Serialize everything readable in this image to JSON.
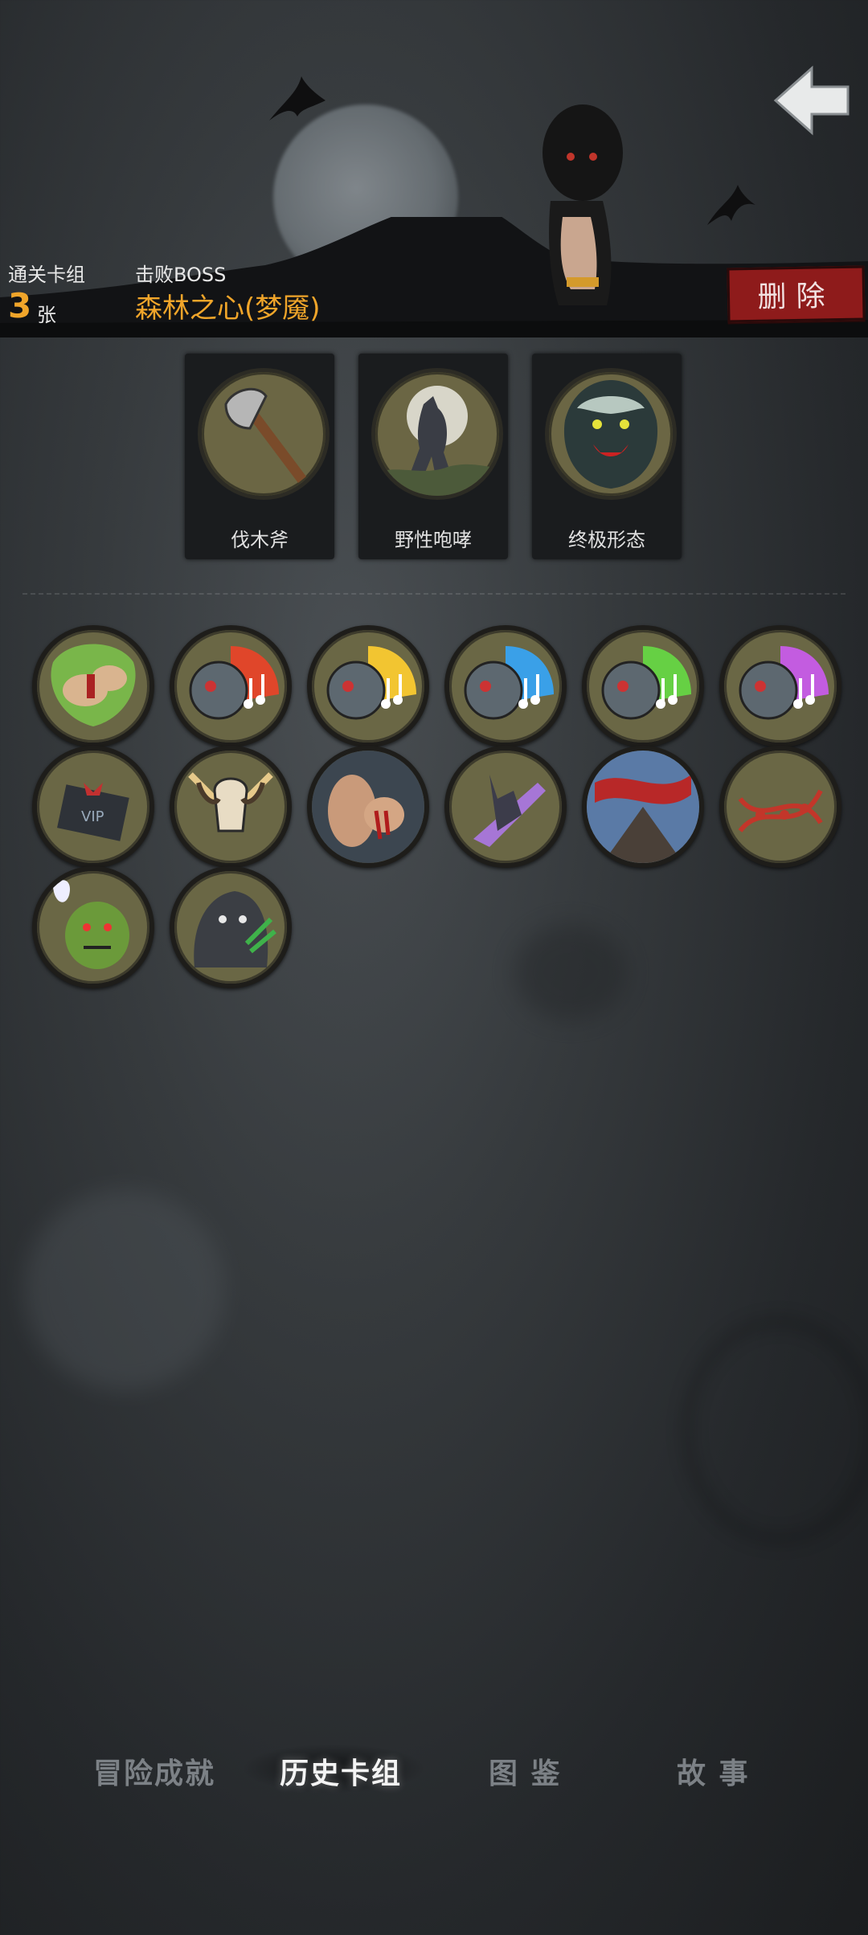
{
  "header": {
    "stats": {
      "deck_label": "通关卡组",
      "deck_count": "3",
      "deck_unit": "张",
      "boss_label": "击败BOSS",
      "boss_name": "森林之心(梦魇)"
    },
    "delete_label": "删除",
    "back_icon": "back-arrow-icon"
  },
  "boss_cards": [
    {
      "label": "伐木斧",
      "icon": "axe-icon"
    },
    {
      "label": "野性咆哮",
      "icon": "werewolf-howl-icon"
    },
    {
      "label": "终极形态",
      "icon": "werewolf-beast-icon"
    }
  ],
  "deck_cards": [
    {
      "icon": "green-fists-icon",
      "accent": "#7fd04c"
    },
    {
      "icon": "zombie-music-red-icon",
      "accent": "#e0462a"
    },
    {
      "icon": "zombie-music-yellow-icon",
      "accent": "#f2c531"
    },
    {
      "icon": "zombie-music-blue-icon",
      "accent": "#3aa0e8"
    },
    {
      "icon": "zombie-music-green-icon",
      "accent": "#66d044"
    },
    {
      "icon": "zombie-music-purple-icon",
      "accent": "#c35ce0"
    },
    {
      "icon": "vip-gift-icon",
      "accent": "#c23030"
    },
    {
      "icon": "horned-skull-icon",
      "accent": "#e6c98a"
    },
    {
      "icon": "bloody-fist-icon",
      "accent": "#b01c1c"
    },
    {
      "icon": "unicorn-beast-icon",
      "accent": "#a676d6"
    },
    {
      "icon": "red-banner-icon",
      "accent": "#b82828"
    },
    {
      "icon": "dna-helix-icon",
      "accent": "#c2362a"
    },
    {
      "icon": "ghost-ogre-icon",
      "accent": "#6b9a3a"
    },
    {
      "icon": "werewolf-claw-icon",
      "accent": "#3fb24a"
    }
  ],
  "tabs": [
    {
      "label": "冒险成就",
      "active": false
    },
    {
      "label": "历史卡组",
      "active": true
    },
    {
      "label": "图 鉴",
      "active": false
    },
    {
      "label": "故 事",
      "active": false
    }
  ]
}
